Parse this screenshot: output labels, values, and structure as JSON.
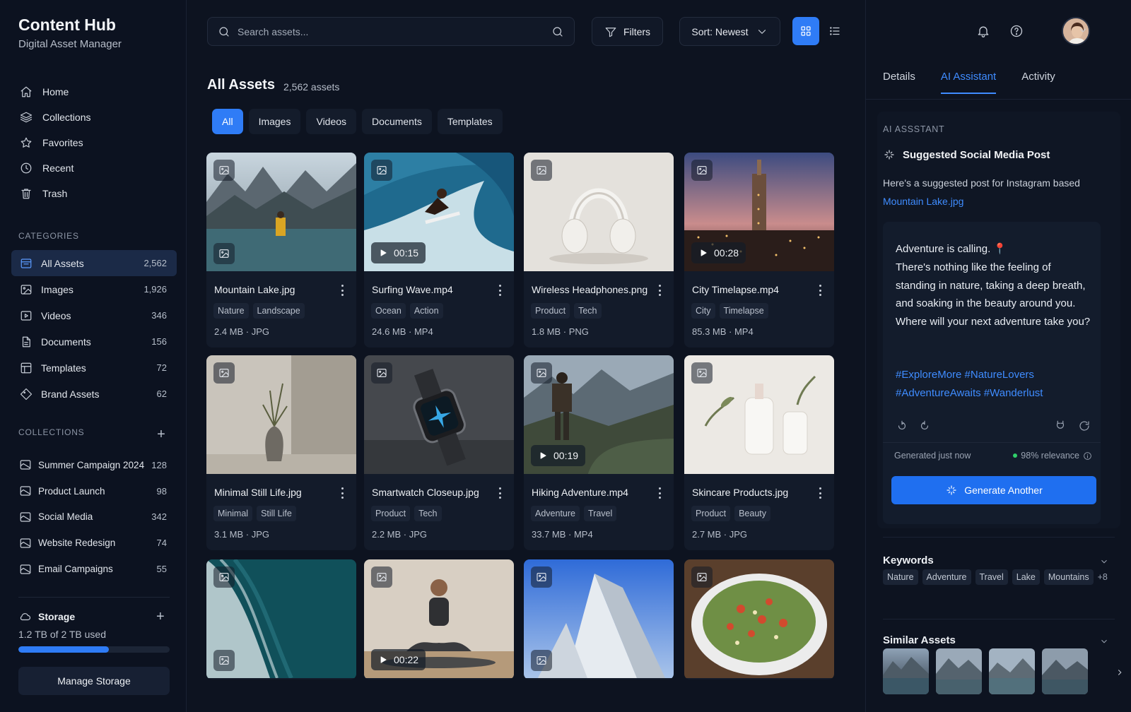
{
  "brand": {
    "title": "Content Hub",
    "subtitle": "Digital Asset Manager"
  },
  "nav": [
    {
      "label": "Home",
      "icon": "home-icon"
    },
    {
      "label": "Collections",
      "icon": "layers-icon"
    },
    {
      "label": "Favorites",
      "icon": "star-icon"
    },
    {
      "label": "Recent",
      "icon": "clock-icon"
    },
    {
      "label": "Trash",
      "icon": "trash-icon"
    }
  ],
  "categories": {
    "label": "CATEGORIES",
    "items": [
      {
        "label": "All Assets",
        "count": "2,562",
        "icon": "all-assets-icon",
        "active": true
      },
      {
        "label": "Images",
        "count": "1,926",
        "icon": "image-icon"
      },
      {
        "label": "Videos",
        "count": "346",
        "icon": "video-icon"
      },
      {
        "label": "Documents",
        "count": "156",
        "icon": "document-icon"
      },
      {
        "label": "Templates",
        "count": "72",
        "icon": "template-icon"
      },
      {
        "label": "Brand Assets",
        "count": "62",
        "icon": "tag-icon"
      }
    ]
  },
  "collections": {
    "label": "COLLECTIONS",
    "items": [
      {
        "label": "Summer Campaign 2024",
        "count": "128"
      },
      {
        "label": "Product Launch",
        "count": "98"
      },
      {
        "label": "Social Media",
        "count": "342"
      },
      {
        "label": "Website Redesign",
        "count": "74"
      },
      {
        "label": "Email Campaigns",
        "count": "55"
      }
    ]
  },
  "storage": {
    "title": "Storage",
    "used": "1.2 TB of 2 TB used",
    "fraction": 0.6,
    "manage_label": "Manage Storage"
  },
  "toolbar": {
    "search_placeholder": "Search assets...",
    "filters_label": "Filters",
    "sort_label": "Sort: Newest"
  },
  "page": {
    "title": "All Assets",
    "count": "2,562 assets"
  },
  "tabs": [
    "All",
    "Images",
    "Videos",
    "Documents",
    "Templates"
  ],
  "assets": [
    {
      "name": "Mountain Lake.jpg",
      "tags": [
        "Nature",
        "Landscape"
      ],
      "meta": "2.4 MB · JPG",
      "type": "image",
      "duration": ""
    },
    {
      "name": "Surfing Wave.mp4",
      "tags": [
        "Ocean",
        "Action"
      ],
      "meta": "24.6 MB · MP4",
      "type": "video",
      "duration": "00:15"
    },
    {
      "name": "Wireless Headphones.png",
      "tags": [
        "Product",
        "Tech"
      ],
      "meta": "1.8 MB · PNG",
      "type": "image",
      "duration": ""
    },
    {
      "name": "City Timelapse.mp4",
      "tags": [
        "City",
        "Timelapse"
      ],
      "meta": "85.3 MB · MP4",
      "type": "video",
      "duration": "00:28"
    },
    {
      "name": "Minimal Still Life.jpg",
      "tags": [
        "Minimal",
        "Still Life"
      ],
      "meta": "3.1 MB · JPG",
      "type": "image",
      "duration": ""
    },
    {
      "name": "Smartwatch Closeup.jpg",
      "tags": [
        "Product",
        "Tech"
      ],
      "meta": "2.2 MB · JPG",
      "type": "image",
      "duration": ""
    },
    {
      "name": "Hiking Adventure.mp4",
      "tags": [
        "Adventure",
        "Travel"
      ],
      "meta": "33.7 MB · MP4",
      "type": "video",
      "duration": "00:19"
    },
    {
      "name": "Skincare Products.jpg",
      "tags": [
        "Product",
        "Beauty"
      ],
      "meta": "2.7 MB · JPG",
      "type": "image",
      "duration": ""
    },
    {
      "name": "",
      "tags": [],
      "meta": "",
      "type": "image",
      "duration": ""
    },
    {
      "name": "",
      "tags": [],
      "meta": "",
      "type": "video",
      "duration": "00:22"
    },
    {
      "name": "",
      "tags": [],
      "meta": "",
      "type": "image",
      "duration": ""
    },
    {
      "name": "",
      "tags": [],
      "meta": "",
      "type": "image",
      "duration": ""
    }
  ],
  "right_tabs": [
    "Details",
    "AI Assistant",
    "Activity"
  ],
  "ai": {
    "label": "AI ASSSTANT",
    "heading": "Suggested Social Media Post",
    "intro": "Here's a suggested post for Instagram based",
    "intro_link": "Mountain Lake.jpg",
    "post_line1": "Adventure is calling. 📍",
    "post_body": "There's nothing like the feeling of standing in nature, taking a deep breath, and soaking in the beauty around you. Where will your next adventure take you?",
    "hashtags_1": "#ExploreMore #NatureLovers",
    "hashtags_2": "#AdventureAwaits #Wanderlust",
    "generated": "Generated just now",
    "relevance": "98% relevance",
    "generate_label": "Generate Another"
  },
  "keywords": {
    "title": "Keywords",
    "items": [
      "Nature",
      "Adventure",
      "Travel",
      "Lake",
      "Mountains"
    ],
    "more": "+8"
  },
  "similar": {
    "title": "Similar Assets"
  },
  "colors": {
    "accent": "#2f7cf6",
    "link": "#3f8cff",
    "background": "#0d1320",
    "card": "#131b2a",
    "success": "#2fcf6a"
  }
}
